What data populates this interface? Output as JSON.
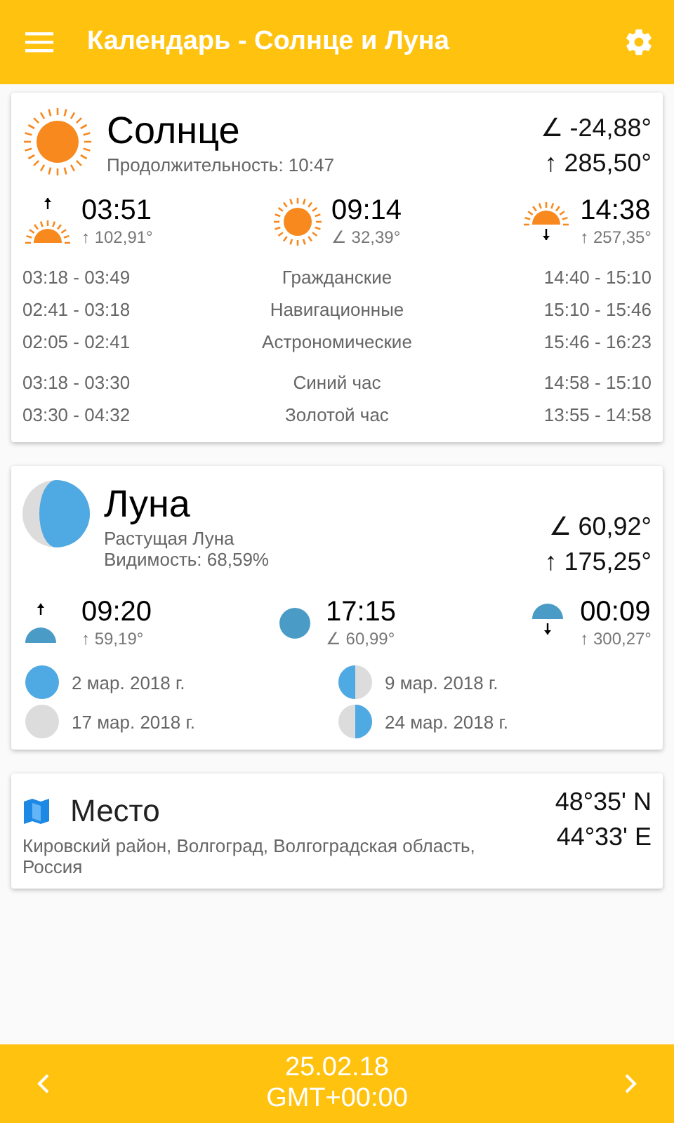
{
  "app_bar": {
    "title": "Календарь - Солнце и Луна"
  },
  "sun": {
    "title": "Солнце",
    "duration": "Продолжительность: 10:47",
    "altitude": "∠ -24,88°",
    "azimuth": "↑ 285,50°",
    "events": [
      {
        "kind": "rise",
        "time": "03:51",
        "angle": "↑ 102,91°"
      },
      {
        "kind": "transit",
        "time": "09:14",
        "angle": "∠ 32,39°"
      },
      {
        "kind": "set",
        "time": "14:38",
        "angle": "↑ 257,35°"
      }
    ],
    "twilight": [
      {
        "morning": "03:18 - 03:49",
        "name": "Гражданские",
        "evening": "14:40 - 15:10"
      },
      {
        "morning": "02:41 - 03:18",
        "name": "Навигационные",
        "evening": "15:10 - 15:46"
      },
      {
        "morning": "02:05 - 02:41",
        "name": "Астрономические",
        "evening": "15:46 - 16:23"
      }
    ],
    "hours": [
      {
        "morning": "03:18 - 03:30",
        "name": "Синий час",
        "evening": "14:58 - 15:10"
      },
      {
        "morning": "03:30 - 04:32",
        "name": "Золотой час",
        "evening": "13:55 - 14:58"
      }
    ]
  },
  "moon": {
    "title": "Луна",
    "kind": "waxing_gibbous",
    "phase": "Растущая Луна",
    "visibility": "Видимость: 68,59%",
    "altitude": "∠ 60,92°",
    "azimuth": "↑ 175,25°",
    "events": [
      {
        "kind": "rise",
        "time": "09:20",
        "angle": "↑ 59,19°"
      },
      {
        "kind": "transit",
        "time": "17:15",
        "angle": "∠ 60,99°"
      },
      {
        "kind": "set",
        "time": "00:09",
        "angle": "↑ 300,27°"
      }
    ],
    "phases": [
      {
        "kind": "full",
        "date": "2 мар. 2018 г."
      },
      {
        "kind": "last_quarter",
        "date": "9 мар. 2018 г."
      },
      {
        "kind": "new",
        "date": "17 мар. 2018 г."
      },
      {
        "kind": "first_quarter",
        "date": "24 мар. 2018 г."
      }
    ]
  },
  "place": {
    "title": "Место",
    "address": "Кировский район, Волгоград, Волгоградская область, Россия",
    "latitude": "48°35' N",
    "longitude": "44°33' E"
  },
  "bottom_bar": {
    "date": "25.02.18",
    "timezone": "GMT+00:00"
  }
}
